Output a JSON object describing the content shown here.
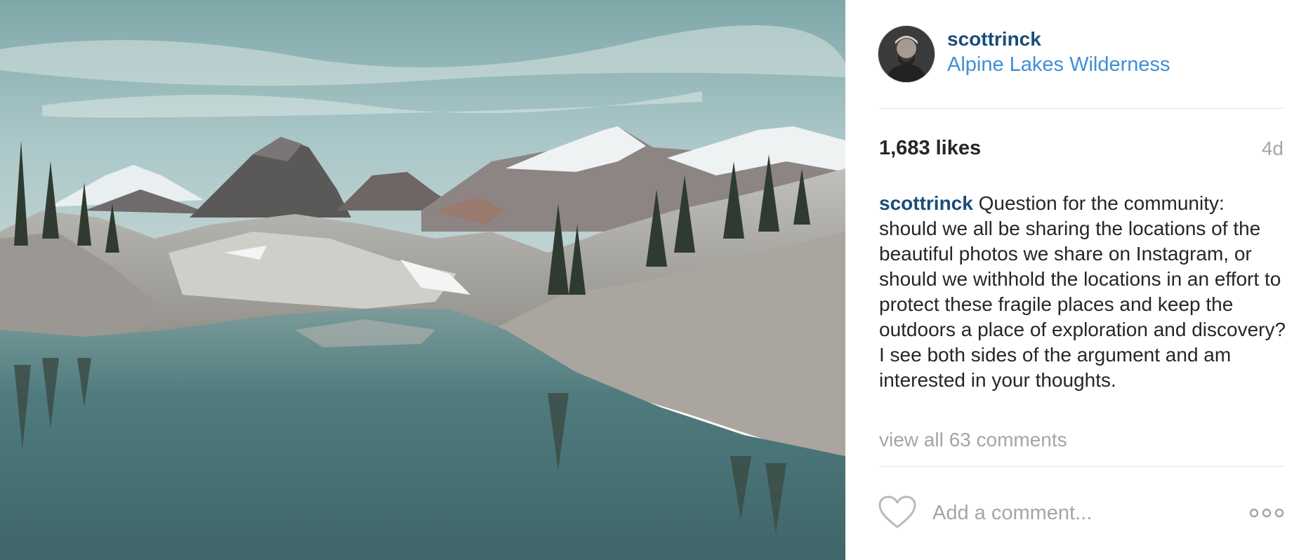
{
  "photo": {
    "icon": "alpine-lake-landscape-photo"
  },
  "post": {
    "username": "scottrinck",
    "location": "Alpine Lakes Wilderness",
    "likes": "1,683 likes",
    "time_ago": "4d",
    "caption_user": "scottrinck",
    "caption_text": "Question for the community: should we all be sharing the locations of the beautiful photos we share on Instagram, or should we withhold the locations in an effort to protect these fragile places and keep the outdoors a place of exploration and discovery? I see both sides of the argument and am interested in your thoughts.",
    "view_comments": "view all 63 comments"
  },
  "comment_bar": {
    "placeholder": "Add a comment...",
    "like_icon": "heart-outline-icon",
    "more_icon": "more-options-icon"
  },
  "colors": {
    "username": "#1a4d7a",
    "link": "#3f8fd6",
    "muted": "#a5a5a5",
    "text": "#262626"
  }
}
